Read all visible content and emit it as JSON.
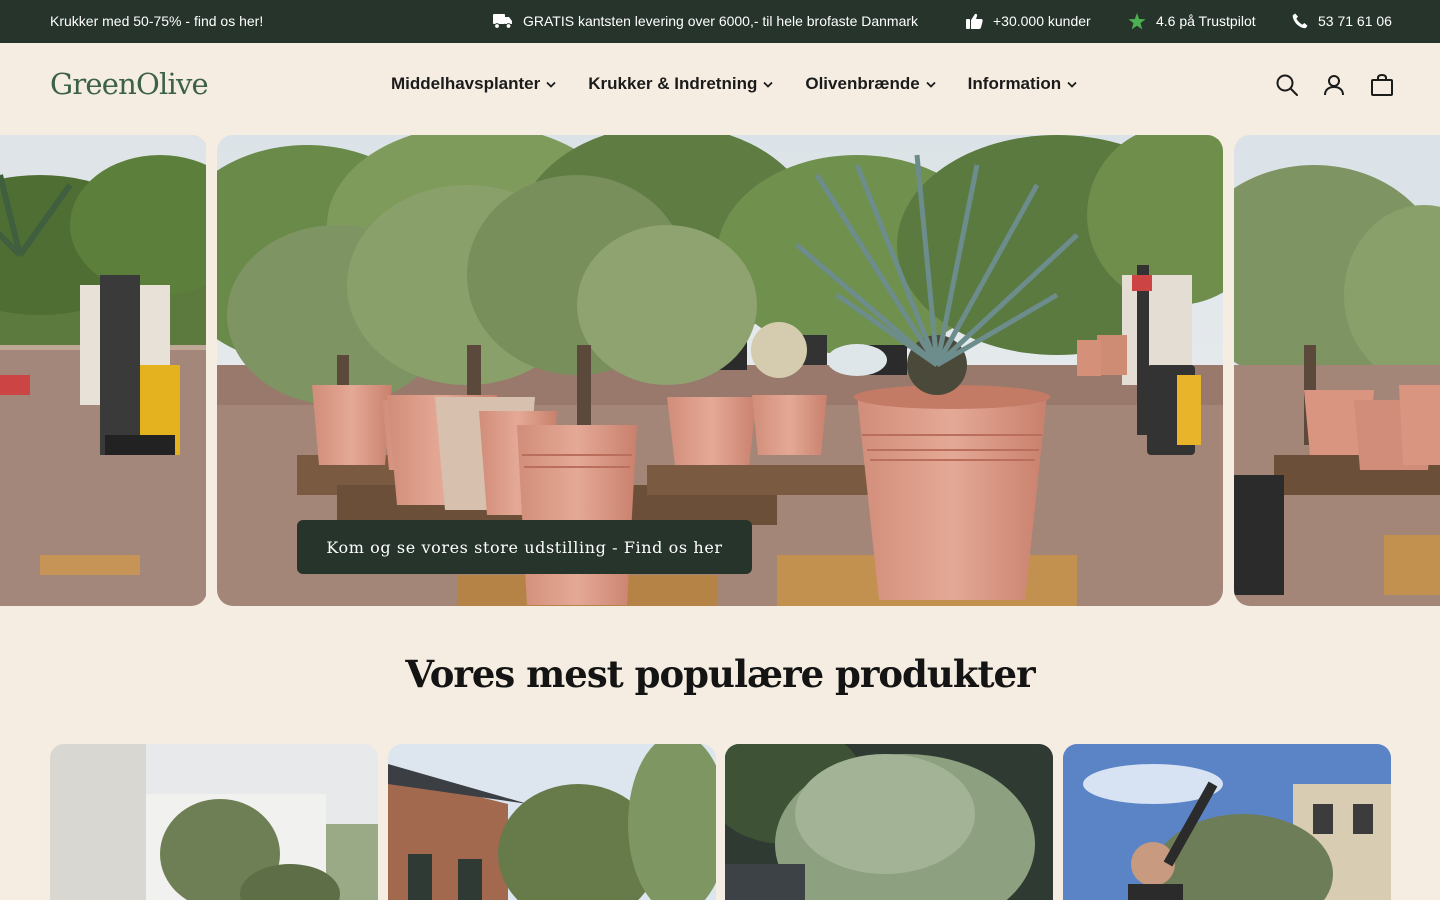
{
  "announcement": {
    "promo": "Krukker med 50-75% - find os her!",
    "delivery": "GRATIS kantsten levering over 6000,- til hele brofaste Danmark",
    "customers": "+30.000 kunder",
    "trustpilot": "4.6 på Trustpilot",
    "phone": "53 71 61 06"
  },
  "header": {
    "logo": "GreenOlive",
    "nav": [
      {
        "label": "Middelhavsplanter"
      },
      {
        "label": "Krukker & Indretning"
      },
      {
        "label": "Olivenbrænde"
      },
      {
        "label": "Information"
      }
    ]
  },
  "hero": {
    "cta_label": "Kom og se vores store udstilling - Find os her"
  },
  "products_section": {
    "title": "Vores mest populære produkter"
  },
  "colors": {
    "page_bg": "#f5ede1",
    "dark_green": "#26342c",
    "logo_green": "#3c6147",
    "trustpilot_star": "#4caf50"
  }
}
